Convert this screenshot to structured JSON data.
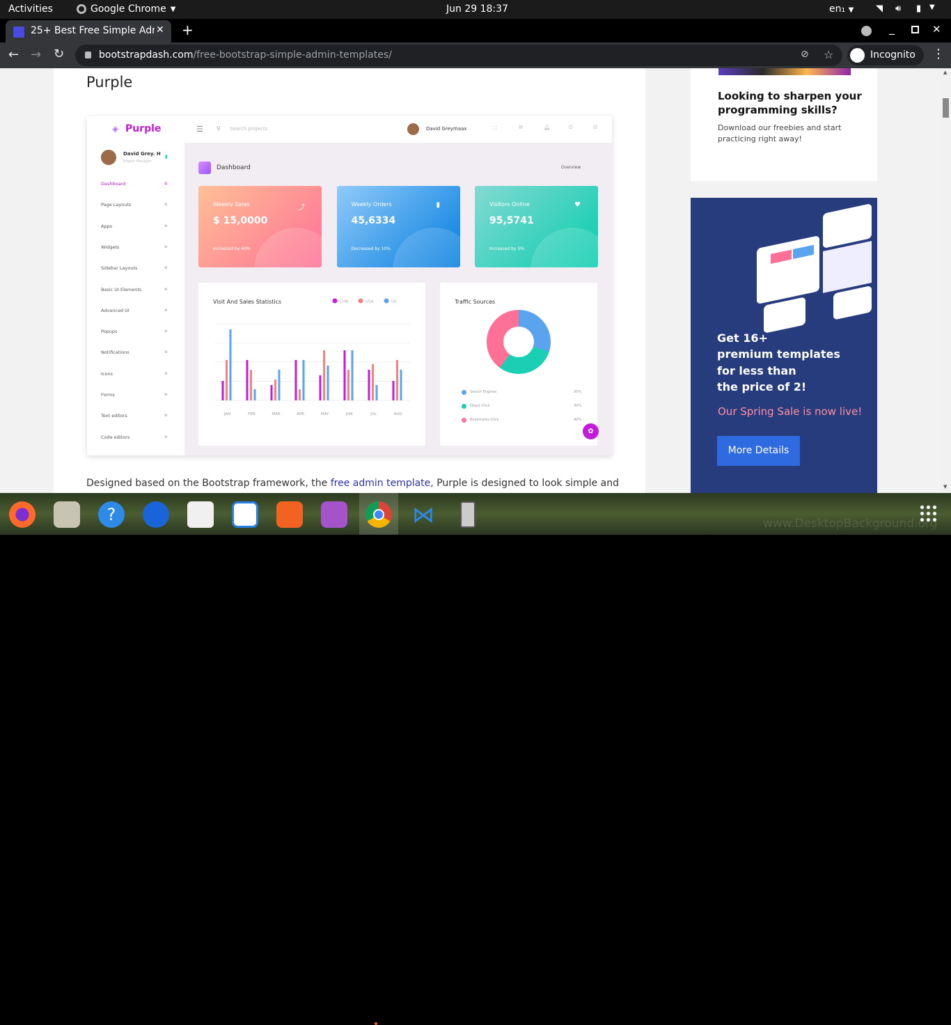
{
  "system": {
    "activities": "Activities",
    "app_name": "Google Chrome",
    "datetime": "Jun 29  18:37",
    "lang": "en₁"
  },
  "tab": {
    "title": "25+ Best Free Simple Adm",
    "new_tab": "+"
  },
  "address": {
    "domain": "bootstrapdash.com",
    "path": "/free-bootstrap-simple-admin-templates/",
    "incognito": "Incognito"
  },
  "article": {
    "heading": "Purple",
    "desc_prefix": "Designed based on the Bootstrap framework, the ",
    "desc_link": "free admin template",
    "desc_suffix": ", Purple is designed to look simple and"
  },
  "preview": {
    "brand": "Purple",
    "search": "Search projects",
    "user": "David Greymaax",
    "profile_name": "David Grey. H",
    "profile_role": "Project Manager",
    "nav": [
      "Dashboard",
      "Page Layouts",
      "Apps",
      "Widgets",
      "Sidebar Layouts",
      "Basic UI Elements",
      "Advanced UI",
      "Popups",
      "Notifications",
      "Icons",
      "Forms",
      "Text editors",
      "Code editors"
    ],
    "page_title": "Dashboard",
    "overview": "Overview",
    "cards": [
      {
        "label": "Weekly Sales",
        "value": "$ 15,0000",
        "note": "Increased by 60%"
      },
      {
        "label": "Weekly Orders",
        "value": "45,6334",
        "note": "Decreased by 10%"
      },
      {
        "label": "Visitors Online",
        "value": "95,5741",
        "note": "Increased by 5%"
      }
    ],
    "stats_title": "Visit And Sales Statistics",
    "traffic_title": "Traffic Sources",
    "traffic": [
      {
        "name": "Search Engines",
        "pct": "30%"
      },
      {
        "name": "Direct Click",
        "pct": "30%"
      },
      {
        "name": "Bookmarks Click",
        "pct": "40%"
      }
    ]
  },
  "chart_data": {
    "type": "bar",
    "title": "Visit And Sales Statistics",
    "categories": [
      "JAN",
      "FEB",
      "MAR",
      "APR",
      "MAY",
      "JUN",
      "JUL",
      "AUG"
    ],
    "series": [
      {
        "name": "CHN",
        "values": [
          28,
          58,
          22,
          58,
          36,
          72,
          44,
          28
        ]
      },
      {
        "name": "USA",
        "values": [
          58,
          44,
          30,
          16,
          72,
          44,
          52,
          58
        ]
      },
      {
        "name": "UK",
        "values": [
          102,
          16,
          44,
          58,
          50,
          72,
          22,
          44
        ]
      }
    ],
    "colors": [
      "#c21bd9",
      "#f4827e",
      "#5aa3ef"
    ],
    "ylim": [
      0,
      110
    ]
  },
  "sidebar_ad": {
    "heading": "Looking to sharpen your programming skills?",
    "sub": "Download our freebies and start practicing right away!"
  },
  "promo": {
    "line1": "Get 16+",
    "line2": "premium templates",
    "line3": "for less than",
    "line4": "the price of 2!",
    "sale": "Our Spring Sale is now live!",
    "button": "More Details"
  },
  "dock_watermark": "www.DesktopBackground.org"
}
